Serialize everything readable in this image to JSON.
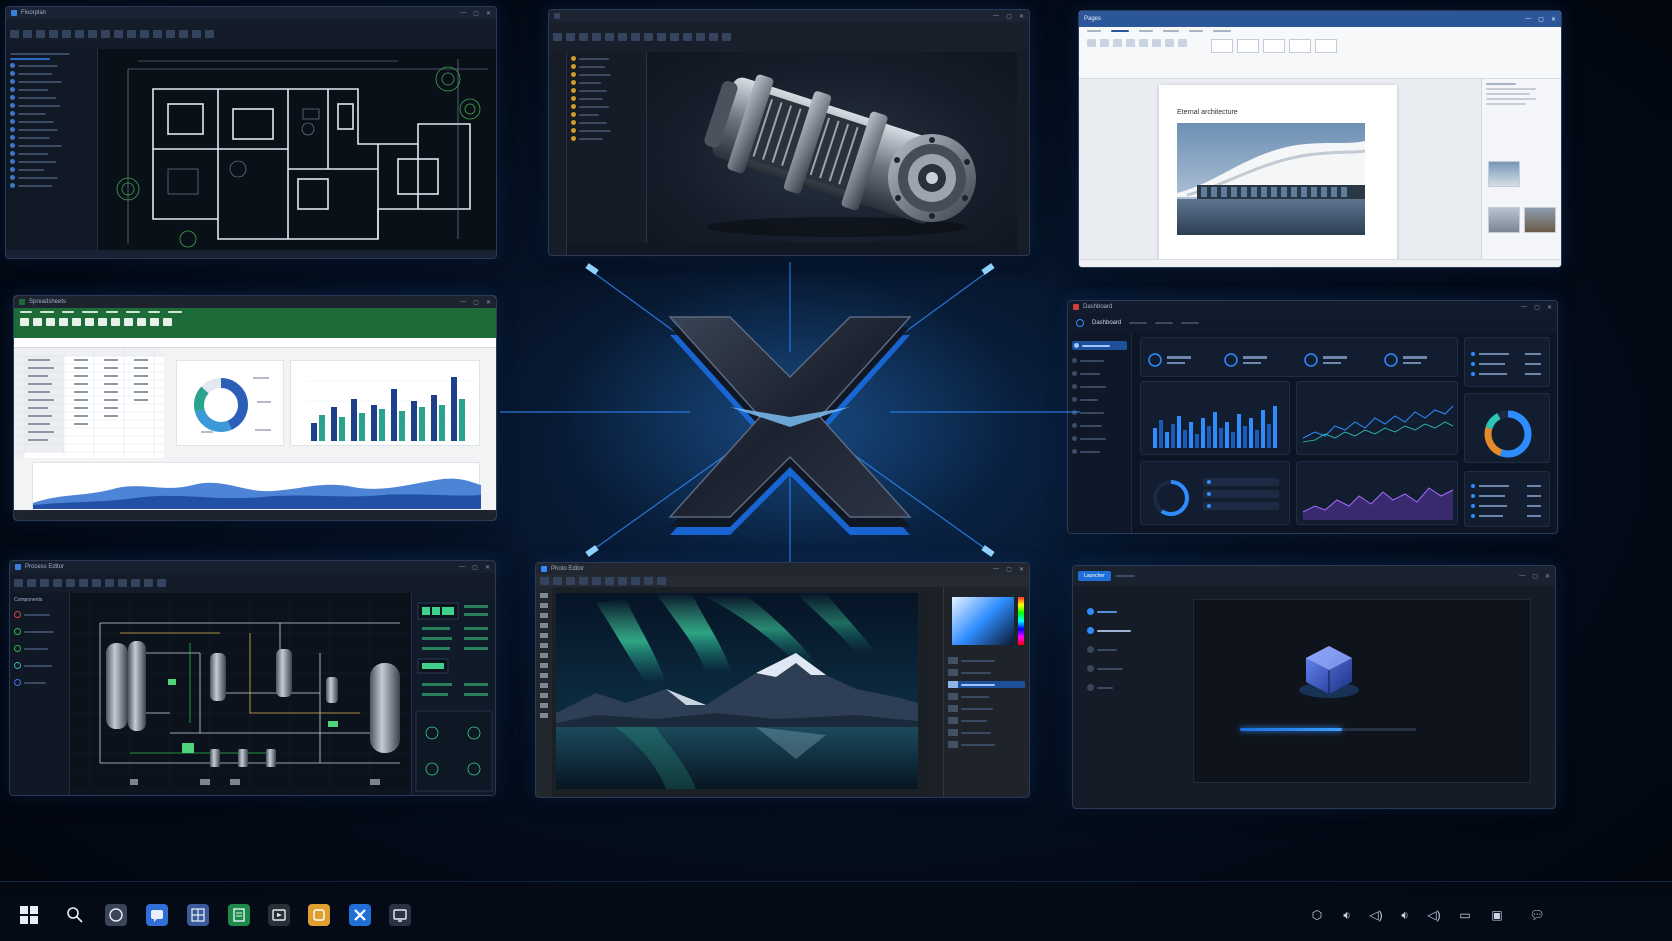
{
  "windows": {
    "cad": {
      "title": "Floorplan"
    },
    "model3d": {
      "title": ""
    },
    "word": {
      "title": "Pages",
      "heading": "Eternal architecture"
    },
    "excel": {
      "title": "Spreadsheets"
    },
    "dashboard": {
      "title": "Dashboard",
      "logo": "Dashboard"
    },
    "pid": {
      "title": "Process Editor",
      "panel_header": "Components"
    },
    "photoshop": {
      "title": "Photo Editor"
    },
    "loader": {
      "tab": "Launcher"
    }
  },
  "taskbar": {
    "apps": [
      "start-icon",
      "search-icon",
      "camera-app-icon",
      "chat-app-icon",
      "cad-app-icon",
      "sheets-app-icon",
      "media-app-icon",
      "folder-app-icon",
      "x-app-icon",
      "monitor-app-icon"
    ],
    "tray": [
      "shield-icon",
      "speaker-icon",
      "speaker-icon",
      "speaker-icon",
      "speaker-icon",
      "display-icon",
      "screen-icon",
      "notification-icon"
    ]
  },
  "colors": {
    "accent": "#2f8cff",
    "excel_green": "#1e6b3a",
    "word_blue": "#2b579a"
  },
  "loader": {
    "progress": 0.58
  }
}
